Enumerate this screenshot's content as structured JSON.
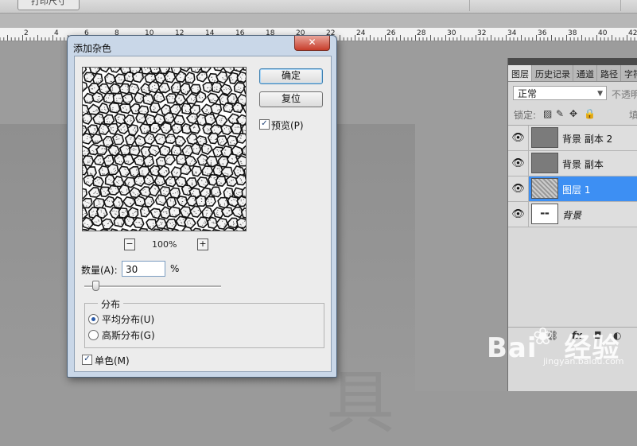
{
  "options_bar": {
    "button_label": "打印尺寸"
  },
  "ruler": {
    "ticks": [
      "2",
      "4",
      "6",
      "8",
      "10",
      "12",
      "14",
      "16",
      "18",
      "20",
      "22",
      "24",
      "26",
      "28",
      "30",
      "32",
      "34",
      "36",
      "38",
      "40",
      "42"
    ]
  },
  "dialog": {
    "title": "添加杂色",
    "close_glyph": "✕",
    "ok_label": "确定",
    "reset_label": "复位",
    "preview_checkbox_label": "预览(P)",
    "preview_checked": true,
    "zoom_minus": "−",
    "zoom_plus": "+",
    "zoom_value": "100%",
    "amount_label": "数量(A):",
    "amount_value": "30",
    "amount_unit": "%",
    "amount_fraction": 0.075,
    "distribution": {
      "legend": "分布",
      "options": [
        {
          "label": "平均分布(U)",
          "selected": true
        },
        {
          "label": "高斯分布(G)",
          "selected": false
        }
      ]
    },
    "monochrome_label": "单色(M)",
    "monochrome_checked": true
  },
  "layers_panel": {
    "tabs": [
      "图层",
      "历史记录",
      "通道",
      "路径",
      "字符"
    ],
    "active_tab": "图层",
    "blend_mode": "正常",
    "opacity_label": "不透明",
    "lock_label": "锁定:",
    "fill_label": "填",
    "layers": [
      {
        "name": "背景 副本 2",
        "thumb": "gray",
        "selected": false
      },
      {
        "name": "背景 副本",
        "thumb": "gray",
        "selected": false
      },
      {
        "name": "图层 1",
        "thumb": "noise",
        "selected": true
      },
      {
        "name": "背景",
        "thumb": "white",
        "selected": false
      }
    ],
    "footer_icons": [
      "link-icon",
      "fx-icon",
      "mask-icon",
      "adjustment-icon"
    ]
  },
  "watermark": {
    "logo_text": "Bai",
    "logo_suffix": "经验",
    "url": "jingyan.baidu.com"
  },
  "colors": {
    "selected_layer": "#3d8ff3",
    "dialog_frame": "#c9d7e8",
    "close_button": "#c73d2b"
  }
}
